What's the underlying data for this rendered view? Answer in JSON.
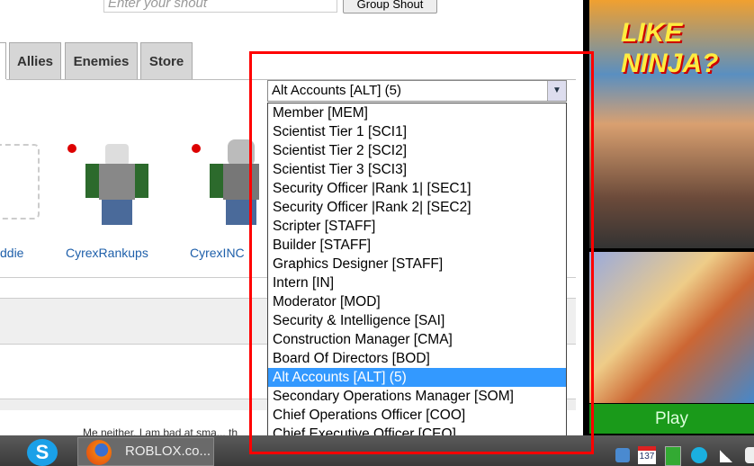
{
  "shout": {
    "placeholder": "Enter your shout",
    "button": "Group Shout"
  },
  "tabs": [
    "Allies",
    "Enemies",
    "Store"
  ],
  "members": [
    {
      "name": "ddie"
    },
    {
      "name": "CyrexRankups"
    },
    {
      "name": "CyrexINC"
    }
  ],
  "role_select": {
    "selected": "Alt Accounts [ALT] (5)",
    "options": [
      "Member [MEM]",
      "Scientist Tier 1 [SCI1]",
      "Scientist Tier 2 [SCI2]",
      "Scientist Tier 3 [SCI3]",
      "Security Officer |Rank 1| [SEC1]",
      "Security Officer |Rank 2| [SEC2]",
      "Scripter [STAFF]",
      "Builder [STAFF]",
      "Graphics Designer [STAFF]",
      "Intern [IN]",
      "Moderator [MOD]",
      "Security & Intelligence [SAI]",
      "Construction Manager [CMA]",
      "Board Of Directors [BOD]",
      "Alt Accounts [ALT] (5)",
      "Secondary Operations Manager [SOM]",
      "Chief Operations Officer [COO]",
      "Chief Executive Officer [CEO]"
    ]
  },
  "post_snippet": "Me neither, I am bad at sma... th",
  "ad": {
    "headline": "LIKE NINJA?",
    "play": "Play"
  },
  "taskbar": {
    "firefox_label": "ROBLOX.co...",
    "calendar_badge": "137"
  },
  "colors": {
    "highlight": "#3399ff",
    "annotation": "#ff0000",
    "play": "#1a9a1a"
  }
}
